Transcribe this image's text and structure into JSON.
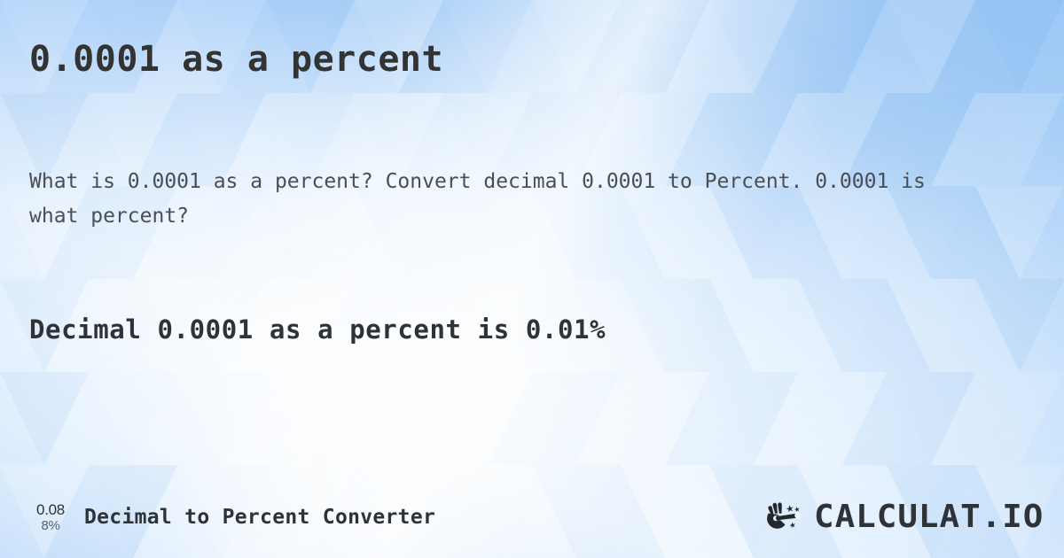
{
  "page": {
    "title": "0.0001 as a percent",
    "description": "What is 0.0001 as a percent? Convert decimal 0.0001 to Percent. 0.0001 is what percent?",
    "result": "Decimal 0.0001 as a percent is 0.01%"
  },
  "values": {
    "decimal_input": "0.0001",
    "percent_output": "0.01%"
  },
  "footer": {
    "icon_top": "0.08",
    "icon_bottom": "8%",
    "icon_name": "decimal-to-percent-icon",
    "label": "Decimal to Percent Converter",
    "brand_name": "CALCULAT.IO",
    "brand_mark_name": "hand-holding-wand-icon"
  },
  "colors": {
    "background_blue": "#b9d9fb",
    "accent_blue": "#9dc8f5",
    "title_text": "#333333",
    "body_text": "#4a4f55",
    "result_text": "#2f3337",
    "brand_text": "#2f3337"
  }
}
